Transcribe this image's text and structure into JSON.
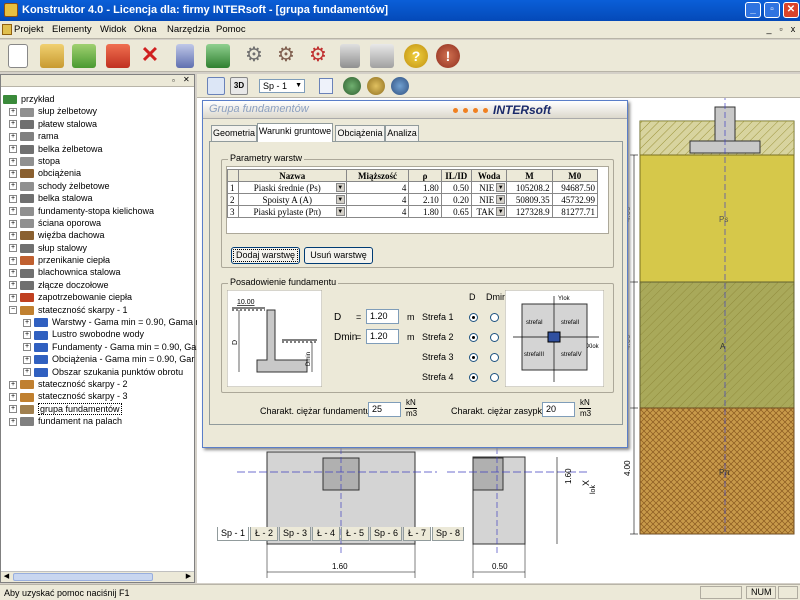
{
  "window": {
    "title": "Konstruktor 4.0 - Licencja dla: firmy INTERsoft - [grupa fundamentów]"
  },
  "menu": [
    "Projekt",
    "Elementy",
    "Widok",
    "Okna",
    "Narzędzia",
    "Pomoc"
  ],
  "tree": {
    "items": [
      {
        "label": "przykład",
        "level": 0,
        "icon": "root",
        "color": "#3a8a3a"
      },
      {
        "label": "słup żelbetowy",
        "level": 1,
        "icon": "column",
        "color": "#909090"
      },
      {
        "label": "płatew stalowa",
        "level": 1,
        "icon": "purlin",
        "color": "#707070"
      },
      {
        "label": "rama",
        "level": 1,
        "icon": "frame",
        "color": "#808080"
      },
      {
        "label": "belka żelbetowa",
        "level": 1,
        "icon": "beam",
        "color": "#707070"
      },
      {
        "label": "stopa",
        "level": 1,
        "icon": "footing",
        "color": "#909090"
      },
      {
        "label": "obciążenia",
        "level": 1,
        "icon": "loads",
        "color": "#8a6030"
      },
      {
        "label": "schody żelbetowe",
        "level": 1,
        "icon": "stairs",
        "color": "#909090"
      },
      {
        "label": "belka stalowa",
        "level": 1,
        "icon": "steel-beam",
        "color": "#707070"
      },
      {
        "label": "fundamenty-stopa kielichowa",
        "level": 1,
        "icon": "socket-footing",
        "color": "#909090"
      },
      {
        "label": "ściana oporowa",
        "level": 1,
        "icon": "retaining-wall",
        "color": "#909090"
      },
      {
        "label": "więźba dachowa",
        "level": 1,
        "icon": "roof",
        "color": "#8a6030"
      },
      {
        "label": "słup stalowy",
        "level": 1,
        "icon": "steel-column",
        "color": "#707070"
      },
      {
        "label": "przenikanie ciepła",
        "level": 1,
        "icon": "heat",
        "color": "#c06030"
      },
      {
        "label": "blachownica stalowa",
        "level": 1,
        "icon": "plate-girder",
        "color": "#707070"
      },
      {
        "label": "złącze doczołowe",
        "level": 1,
        "icon": "joint",
        "color": "#707070"
      },
      {
        "label": "zapotrzebowanie ciepła",
        "level": 1,
        "icon": "heat-demand",
        "color": "#c04020"
      },
      {
        "label": "stateczność skarpy - 1",
        "level": 1,
        "icon": "slope",
        "color": "#c08030",
        "expanded": true
      },
      {
        "label": "Warstwy  -  Gama min = 0.90, Gama m",
        "level": 2,
        "icon": "folder",
        "color": "#3060c0"
      },
      {
        "label": "Lustro swobodne wody",
        "level": 2,
        "icon": "folder",
        "color": "#3060c0"
      },
      {
        "label": "Fundamenty  -  Gama min = 0.90, Gar",
        "level": 2,
        "icon": "folder",
        "color": "#3060c0"
      },
      {
        "label": "Obciążenia  -  Gama min = 0.90, Gar",
        "level": 2,
        "icon": "folder",
        "color": "#3060c0"
      },
      {
        "label": "Obszar szukania punktów obrotu",
        "level": 2,
        "icon": "folder",
        "color": "#3060c0"
      },
      {
        "label": "stateczność skarpy - 2",
        "level": 1,
        "icon": "slope",
        "color": "#c08030"
      },
      {
        "label": "stateczność skarpy - 3",
        "level": 1,
        "icon": "slope",
        "color": "#c08030"
      },
      {
        "label": "grupa fundamentów",
        "level": 1,
        "icon": "foundation-group",
        "color": "#a08050",
        "selected": true
      },
      {
        "label": "fundament na palach",
        "level": 1,
        "icon": "piles",
        "color": "#808080"
      }
    ]
  },
  "subtoolbar": {
    "sp_select": "Sp - 1"
  },
  "dialog": {
    "title": "Grupa fundamentów",
    "brand": "INTERsoft",
    "tabs": [
      "Geometria",
      "Warunki gruntowe",
      "Obciążenia",
      "Analiza"
    ],
    "active_tab": 1,
    "layers": {
      "group_label": "Parametry warstw",
      "headers": [
        "",
        "Nazwa",
        "Miąższość",
        "ρ",
        "IL/ID",
        "Woda",
        "M",
        "M0"
      ],
      "rows": [
        {
          "n": "1",
          "name": "Piaski średnie (Ps)",
          "thk": "4",
          "rho": "1.80",
          "il": "0.50",
          "water": "NIE",
          "m": "105208.2",
          "m0": "94687.50"
        },
        {
          "n": "2",
          "name": "Spoisty A (A)",
          "thk": "4",
          "rho": "2.10",
          "il": "0.20",
          "water": "NIE",
          "m": "50809.35",
          "m0": "45732.99"
        },
        {
          "n": "3",
          "name": "Piaski pylaste (Pπ)",
          "thk": "4",
          "rho": "1.80",
          "il": "0.65",
          "water": "TAK",
          "m": "127328.9",
          "m0": "81277.71"
        }
      ],
      "add_button": "Dodaj warstwę",
      "remove_button": "Usuń warstwę"
    },
    "foundation": {
      "group_label": "Posadowienie fundamentu",
      "level_label": "10.00",
      "d_label": "D",
      "dmin_label": "Dmin",
      "eq": "=",
      "d_value": "1.20",
      "dmin_value": "1.20",
      "unit": "m",
      "col_d": "D",
      "col_dmin": "Dmin",
      "zones": [
        "Strefa 1",
        "Strefa 2",
        "Strefa 3",
        "Strefa 4"
      ],
      "zone_d": [
        true,
        true,
        true,
        true
      ],
      "zone_dmin": [
        false,
        false,
        false,
        false
      ],
      "diagram": {
        "ylok": "Ylok",
        "xlok": "Xlok",
        "s1": "strefaI",
        "s2": "strefaII",
        "s3": "strefaIII",
        "s4": "strefaIV"
      }
    },
    "weights": {
      "foundation_label": "Charakt. ciężar fundamentu",
      "foundation_value": "25",
      "fill_label": "Charakt. ciężar zasypki",
      "fill_value": "20",
      "unit_top": "kN",
      "unit_bottom": "m3"
    },
    "bottom_tabs": [
      "Sp - 1",
      "Ł - 2",
      "Sp - 3",
      "Ł - 4",
      "Ł - 5",
      "Sp - 6",
      "Ł - 7",
      "Sp - 8"
    ]
  },
  "drawing": {
    "soil_labels": [
      "Ps",
      "A",
      "Pπ"
    ],
    "depths": [
      "4.00",
      "4.00",
      "4.00"
    ],
    "dim1": "1.60",
    "dim2": "0.50",
    "dim_v": "1.60",
    "xlok": "X",
    "xlok_sub": "lok"
  },
  "status": {
    "help": "Aby uzyskać pomoc naciśnij F1",
    "num": "NUM"
  },
  "colors": {
    "soil_ps": "#d6c84a",
    "soil_a": "#a9a95a",
    "soil_pi": "#c89a4a",
    "title_blue": "#0a5fd8"
  }
}
